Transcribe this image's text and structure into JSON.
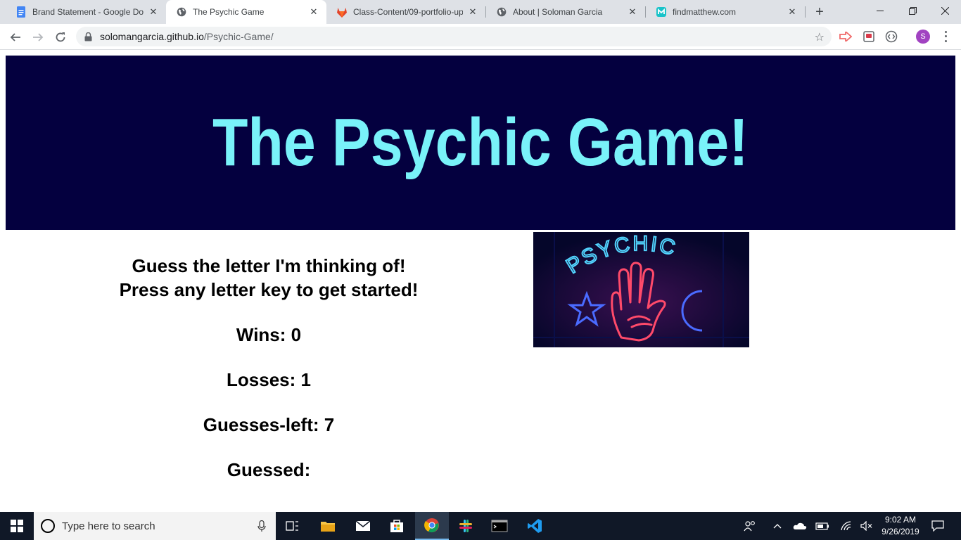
{
  "browser": {
    "tabs": [
      {
        "title": "Brand Statement - Google Doc",
        "icon": "google-docs-icon"
      },
      {
        "title": "The Psychic Game",
        "icon": "globe-icon"
      },
      {
        "title": "Class-Content/09-portfolio-up",
        "icon": "gitlab-icon"
      },
      {
        "title": "About | Soloman Garcia",
        "icon": "globe-icon"
      },
      {
        "title": "findmatthew.com",
        "icon": "site-icon"
      }
    ],
    "active_tab_index": 1,
    "new_tab_symbol": "+",
    "url_host": "solomangarcia.github.io",
    "url_path": "/Psychic-Game/",
    "profile_initial": "S",
    "accent_color": "#a142c1"
  },
  "page": {
    "banner_title": "The Psychic Game!",
    "banner_bg": "#04003f",
    "banner_fg": "#79f2f9",
    "instructions_line1": "Guess the letter I'm thinking of!",
    "instructions_line2": "Press any letter key to get started!",
    "wins_text": "Wins: 0",
    "losses_text": "Losses: 1",
    "guesses_left_text": "Guesses-left: 7",
    "guessed_text": "Guessed:",
    "image_sign_text": "PSYCHIC"
  },
  "taskbar": {
    "search_placeholder": "Type here to search",
    "time": "9:02 AM",
    "date": "9/26/2019"
  }
}
